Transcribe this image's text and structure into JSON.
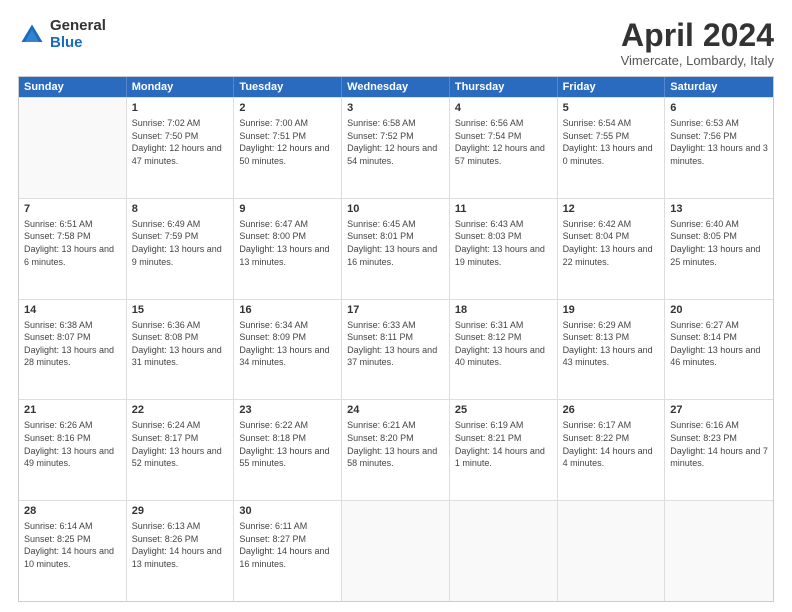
{
  "logo": {
    "general": "General",
    "blue": "Blue"
  },
  "title": "April 2024",
  "subtitle": "Vimercate, Lombardy, Italy",
  "header_days": [
    "Sunday",
    "Monday",
    "Tuesday",
    "Wednesday",
    "Thursday",
    "Friday",
    "Saturday"
  ],
  "weeks": [
    [
      {
        "day": "",
        "empty": true
      },
      {
        "day": "1",
        "sunrise": "Sunrise: 7:02 AM",
        "sunset": "Sunset: 7:50 PM",
        "daylight": "Daylight: 12 hours and 47 minutes."
      },
      {
        "day": "2",
        "sunrise": "Sunrise: 7:00 AM",
        "sunset": "Sunset: 7:51 PM",
        "daylight": "Daylight: 12 hours and 50 minutes."
      },
      {
        "day": "3",
        "sunrise": "Sunrise: 6:58 AM",
        "sunset": "Sunset: 7:52 PM",
        "daylight": "Daylight: 12 hours and 54 minutes."
      },
      {
        "day": "4",
        "sunrise": "Sunrise: 6:56 AM",
        "sunset": "Sunset: 7:54 PM",
        "daylight": "Daylight: 12 hours and 57 minutes."
      },
      {
        "day": "5",
        "sunrise": "Sunrise: 6:54 AM",
        "sunset": "Sunset: 7:55 PM",
        "daylight": "Daylight: 13 hours and 0 minutes."
      },
      {
        "day": "6",
        "sunrise": "Sunrise: 6:53 AM",
        "sunset": "Sunset: 7:56 PM",
        "daylight": "Daylight: 13 hours and 3 minutes."
      }
    ],
    [
      {
        "day": "7",
        "sunrise": "Sunrise: 6:51 AM",
        "sunset": "Sunset: 7:58 PM",
        "daylight": "Daylight: 13 hours and 6 minutes."
      },
      {
        "day": "8",
        "sunrise": "Sunrise: 6:49 AM",
        "sunset": "Sunset: 7:59 PM",
        "daylight": "Daylight: 13 hours and 9 minutes."
      },
      {
        "day": "9",
        "sunrise": "Sunrise: 6:47 AM",
        "sunset": "Sunset: 8:00 PM",
        "daylight": "Daylight: 13 hours and 13 minutes."
      },
      {
        "day": "10",
        "sunrise": "Sunrise: 6:45 AM",
        "sunset": "Sunset: 8:01 PM",
        "daylight": "Daylight: 13 hours and 16 minutes."
      },
      {
        "day": "11",
        "sunrise": "Sunrise: 6:43 AM",
        "sunset": "Sunset: 8:03 PM",
        "daylight": "Daylight: 13 hours and 19 minutes."
      },
      {
        "day": "12",
        "sunrise": "Sunrise: 6:42 AM",
        "sunset": "Sunset: 8:04 PM",
        "daylight": "Daylight: 13 hours and 22 minutes."
      },
      {
        "day": "13",
        "sunrise": "Sunrise: 6:40 AM",
        "sunset": "Sunset: 8:05 PM",
        "daylight": "Daylight: 13 hours and 25 minutes."
      }
    ],
    [
      {
        "day": "14",
        "sunrise": "Sunrise: 6:38 AM",
        "sunset": "Sunset: 8:07 PM",
        "daylight": "Daylight: 13 hours and 28 minutes."
      },
      {
        "day": "15",
        "sunrise": "Sunrise: 6:36 AM",
        "sunset": "Sunset: 8:08 PM",
        "daylight": "Daylight: 13 hours and 31 minutes."
      },
      {
        "day": "16",
        "sunrise": "Sunrise: 6:34 AM",
        "sunset": "Sunset: 8:09 PM",
        "daylight": "Daylight: 13 hours and 34 minutes."
      },
      {
        "day": "17",
        "sunrise": "Sunrise: 6:33 AM",
        "sunset": "Sunset: 8:11 PM",
        "daylight": "Daylight: 13 hours and 37 minutes."
      },
      {
        "day": "18",
        "sunrise": "Sunrise: 6:31 AM",
        "sunset": "Sunset: 8:12 PM",
        "daylight": "Daylight: 13 hours and 40 minutes."
      },
      {
        "day": "19",
        "sunrise": "Sunrise: 6:29 AM",
        "sunset": "Sunset: 8:13 PM",
        "daylight": "Daylight: 13 hours and 43 minutes."
      },
      {
        "day": "20",
        "sunrise": "Sunrise: 6:27 AM",
        "sunset": "Sunset: 8:14 PM",
        "daylight": "Daylight: 13 hours and 46 minutes."
      }
    ],
    [
      {
        "day": "21",
        "sunrise": "Sunrise: 6:26 AM",
        "sunset": "Sunset: 8:16 PM",
        "daylight": "Daylight: 13 hours and 49 minutes."
      },
      {
        "day": "22",
        "sunrise": "Sunrise: 6:24 AM",
        "sunset": "Sunset: 8:17 PM",
        "daylight": "Daylight: 13 hours and 52 minutes."
      },
      {
        "day": "23",
        "sunrise": "Sunrise: 6:22 AM",
        "sunset": "Sunset: 8:18 PM",
        "daylight": "Daylight: 13 hours and 55 minutes."
      },
      {
        "day": "24",
        "sunrise": "Sunrise: 6:21 AM",
        "sunset": "Sunset: 8:20 PM",
        "daylight": "Daylight: 13 hours and 58 minutes."
      },
      {
        "day": "25",
        "sunrise": "Sunrise: 6:19 AM",
        "sunset": "Sunset: 8:21 PM",
        "daylight": "Daylight: 14 hours and 1 minute."
      },
      {
        "day": "26",
        "sunrise": "Sunrise: 6:17 AM",
        "sunset": "Sunset: 8:22 PM",
        "daylight": "Daylight: 14 hours and 4 minutes."
      },
      {
        "day": "27",
        "sunrise": "Sunrise: 6:16 AM",
        "sunset": "Sunset: 8:23 PM",
        "daylight": "Daylight: 14 hours and 7 minutes."
      }
    ],
    [
      {
        "day": "28",
        "sunrise": "Sunrise: 6:14 AM",
        "sunset": "Sunset: 8:25 PM",
        "daylight": "Daylight: 14 hours and 10 minutes."
      },
      {
        "day": "29",
        "sunrise": "Sunrise: 6:13 AM",
        "sunset": "Sunset: 8:26 PM",
        "daylight": "Daylight: 14 hours and 13 minutes."
      },
      {
        "day": "30",
        "sunrise": "Sunrise: 6:11 AM",
        "sunset": "Sunset: 8:27 PM",
        "daylight": "Daylight: 14 hours and 16 minutes."
      },
      {
        "day": "",
        "empty": true
      },
      {
        "day": "",
        "empty": true
      },
      {
        "day": "",
        "empty": true
      },
      {
        "day": "",
        "empty": true
      }
    ]
  ]
}
